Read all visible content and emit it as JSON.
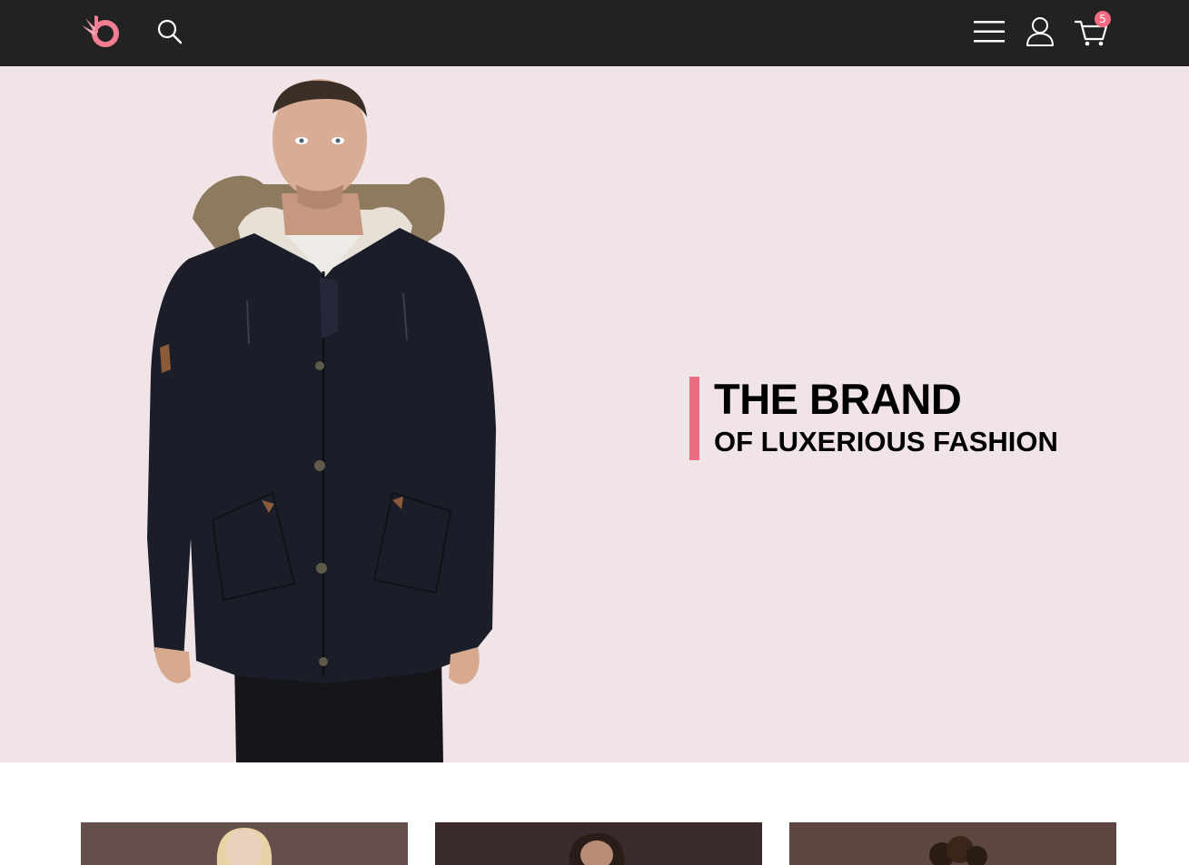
{
  "header": {
    "background": "#222222",
    "logo": "brand-logo",
    "icons": [
      "search-icon",
      "hamburger-menu-icon",
      "user-icon",
      "cart-icon"
    ],
    "cart_count": "5",
    "badge_color": "#f06a80"
  },
  "hero": {
    "background": "#f0e4e7",
    "accent_color": "#ec6d82",
    "title": "THE BRAND",
    "subtitle": "OF LUXERIOUS FASHION",
    "image": "model-in-dark-parka-with-fur-hood"
  },
  "category_cards": [
    {
      "image": "woman-portrait"
    },
    {
      "image": "man-portrait"
    },
    {
      "image": "curly-hair-portrait"
    }
  ]
}
